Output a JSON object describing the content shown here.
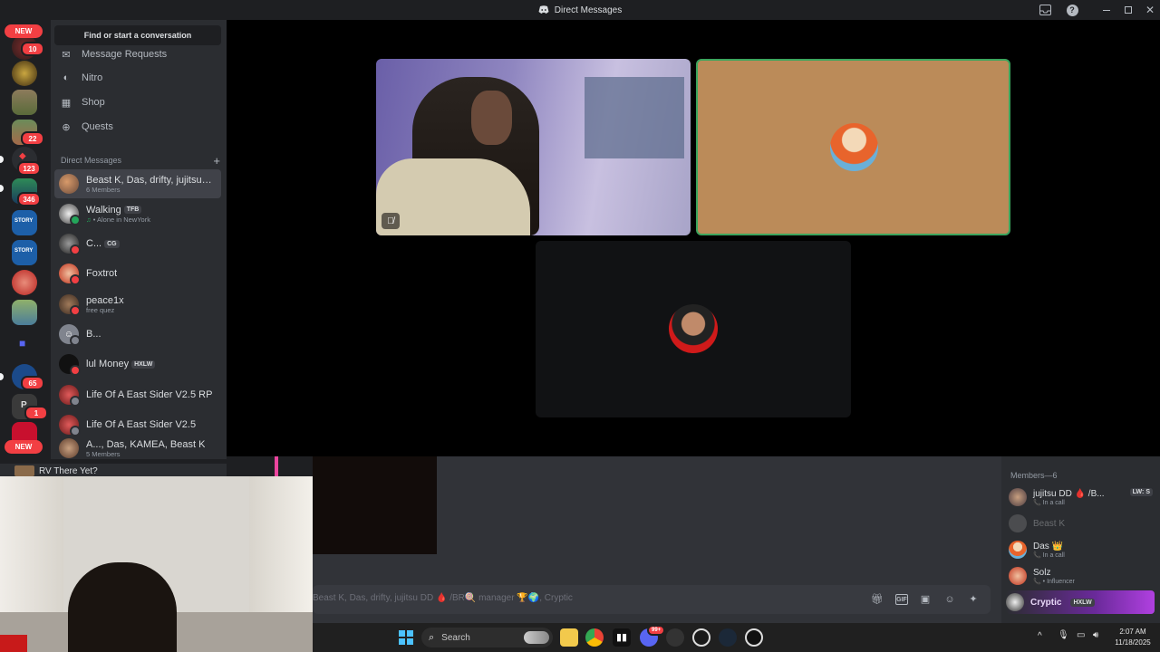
{
  "window": {
    "title": "Direct Messages",
    "controls": [
      "inbox-icon",
      "help-icon",
      "minimize-icon",
      "maximize-icon",
      "close-icon"
    ]
  },
  "rail": {
    "new_label_top": "NEW",
    "new_label_bottom": "NEW",
    "badges": [
      "10",
      "22",
      "123",
      "346",
      "65",
      "1"
    ]
  },
  "sidebar": {
    "find_button": "Find or start a conversation",
    "nav": [
      {
        "label": "Message Requests",
        "icon": "envelope-icon"
      },
      {
        "label": "Nitro",
        "icon": "nitro-icon"
      },
      {
        "label": "Shop",
        "icon": "shop-icon"
      },
      {
        "label": "Quests",
        "icon": "quests-icon"
      }
    ],
    "dm_header": "Direct Messages",
    "dms": [
      {
        "name": "Beast K, Das, drifty, jujitsu D...",
        "sub": "6 Members",
        "tag": "",
        "active": true
      },
      {
        "name": "Walking",
        "sub": "• Alone in NewYork",
        "tag": "TFB"
      },
      {
        "name": "C...",
        "sub": "",
        "tag": "CG"
      },
      {
        "name": "Foxtrot",
        "sub": "",
        "tag": ""
      },
      {
        "name": "peace1x",
        "sub": "free quez",
        "tag": ""
      },
      {
        "name": "B...",
        "sub": "",
        "tag": ""
      },
      {
        "name": "lul Money",
        "sub": "",
        "tag": "HXLW"
      },
      {
        "name": "Life Of A East Sider V2.5 RP",
        "sub": "",
        "tag": ""
      },
      {
        "name": "Life Of A East Sider V2.5",
        "sub": "",
        "tag": ""
      },
      {
        "name": "A..., Das, KAMEA, Beast K",
        "sub": "5 Members",
        "tag": ""
      }
    ],
    "overlay_label": "RV There Yet?"
  },
  "members": {
    "header": "Members—6",
    "list": [
      {
        "name": "jujitsu DD 🩸 /B...",
        "sub": "In a call",
        "tag": "LW: S"
      },
      {
        "name": "Beast K",
        "sub": "",
        "tag": ""
      },
      {
        "name": "Das 👑",
        "sub": "In a call",
        "tag": ""
      },
      {
        "name": "Solz",
        "sub": "• Influencer",
        "tag": ""
      },
      {
        "name": "Cryptic",
        "sub": "",
        "tag": "HXLW"
      }
    ]
  },
  "composer": {
    "placeholder": "Beast K, Das, drifty, jujitsu DD 🩸 /BR🍭 manager 🏆🌍, Cryptic",
    "icons": [
      "gift-icon",
      "gif-icon",
      "sticker-icon",
      "emoji-icon",
      "apps-icon"
    ]
  },
  "taskbar": {
    "search_label": "Search",
    "time": "2:07 AM",
    "date": "11/18/2025",
    "discord_badge": "99+"
  },
  "colors": {
    "accent": "#5865f2",
    "green": "#23a55a",
    "red": "#f23f43",
    "speaking_border": "#3ba55d",
    "tile_tan": "#bb8b59"
  }
}
